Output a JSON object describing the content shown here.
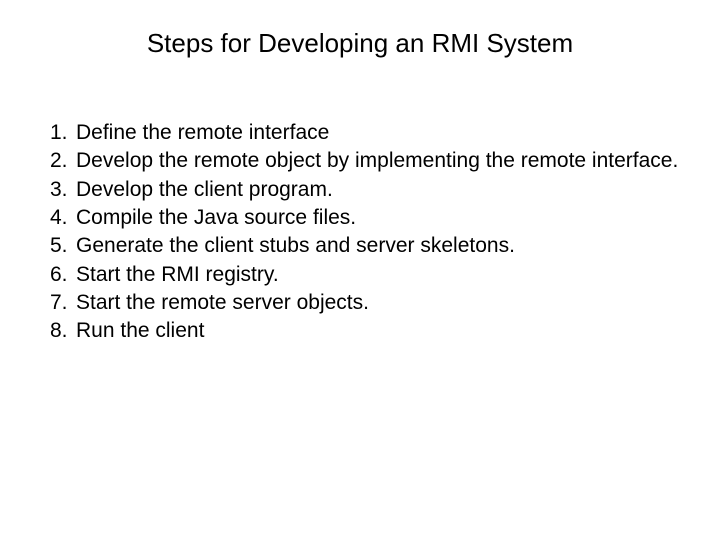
{
  "title": "Steps for Developing an RMI System",
  "steps": [
    {
      "num": "1.",
      "text": "Define the remote interface"
    },
    {
      "num": "2.",
      "text": "Develop the remote object by implementing the remote interface."
    },
    {
      "num": "3.",
      "text": "Develop the client program."
    },
    {
      "num": "4.",
      "text": "Compile the Java source files."
    },
    {
      "num": "5.",
      "text": "Generate the client stubs and server skeletons."
    },
    {
      "num": "6.",
      "text": "Start the RMI registry."
    },
    {
      "num": "7.",
      "text": "Start the remote server objects."
    },
    {
      "num": "8.",
      "text": "Run the client"
    }
  ]
}
